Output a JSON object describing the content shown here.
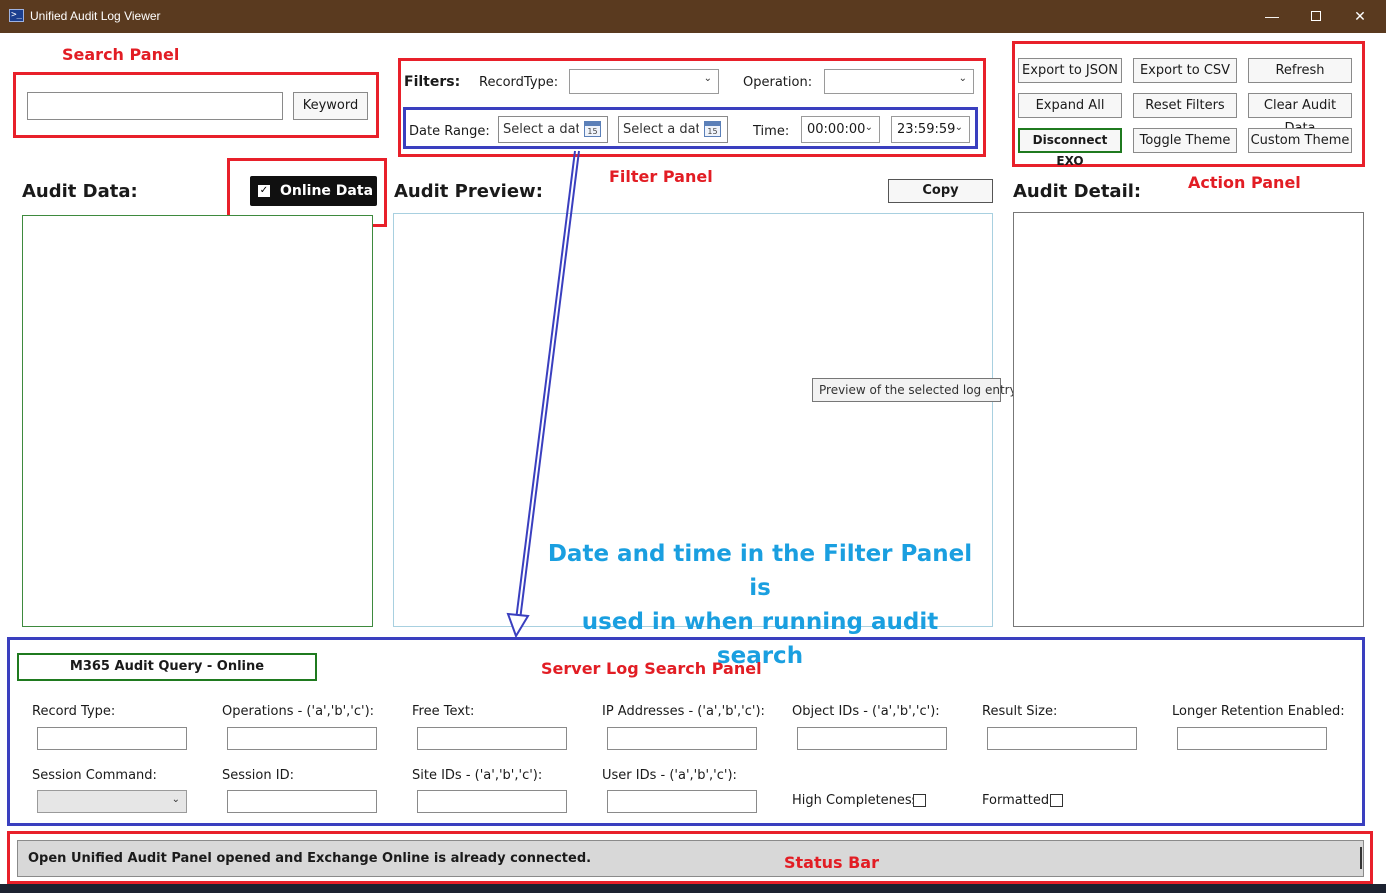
{
  "window": {
    "title": "Unified Audit Log Viewer",
    "min": "—",
    "close": "✕"
  },
  "annotations": {
    "search_panel": "Search Panel",
    "filter_panel": "Filter Panel",
    "action_panel": "Action Panel",
    "server_log_panel": "Server Log Search Panel",
    "status_bar": "Status Bar",
    "note_line1": "Date and time in the Filter Panel is",
    "note_line2": "used in when running audit search"
  },
  "search": {
    "keyword_value": "",
    "keyword_button": "Keyword"
  },
  "filters": {
    "label": "Filters:",
    "record_type_label": "RecordType:",
    "record_type_value": "",
    "operation_label": "Operation:",
    "operation_value": "",
    "date_range_label": "Date Range:",
    "start_date_placeholder": "Select a date",
    "end_date_placeholder": "Select a date",
    "calendar_day": "15",
    "time_label": "Time:",
    "time_start": "00:00:00",
    "time_end": "23:59:59"
  },
  "actions": {
    "export_json": "Export to JSON",
    "export_csv": "Export to CSV",
    "refresh": "Refresh",
    "expand_all": "Expand All",
    "reset_filters": "Reset Filters",
    "clear_audit_data": "Clear Audit Data",
    "disconnect_exo": "Disconnect EXO",
    "toggle_theme": "Toggle Theme",
    "custom_theme": "Custom Theme"
  },
  "audit_data": {
    "heading": "Audit Data:",
    "online_toggle": "Online Data",
    "online_checked": true
  },
  "audit_preview": {
    "heading": "Audit Preview:",
    "copy_button": "Copy",
    "tooltip": "Preview of the selected log entry."
  },
  "audit_detail": {
    "heading": "Audit Detail:"
  },
  "server_search": {
    "query_button": "M365 Audit Query - Online",
    "record_type": "Record Type:",
    "operations": "Operations - ('a','b','c'):",
    "free_text": "Free Text:",
    "ip_addresses": "IP Addresses - ('a','b','c'):",
    "object_ids": "Object IDs - ('a','b','c'):",
    "result_size": "Result Size:",
    "longer_retention": "Longer Retention Enabled:",
    "session_command": "Session Command:",
    "session_id": "Session ID:",
    "site_ids": "Site IDs - ('a','b','c'):",
    "user_ids": "User IDs - ('a','b','c'):",
    "high_completeness": "High Completeness:",
    "formatted": "Formatted:"
  },
  "status": {
    "message": "Open Unified Audit Panel opened and Exchange Online is already connected."
  },
  "colors": {
    "annotation_red": "#e8202a",
    "annotation_blue": "#3a3fbf",
    "note_blue": "#1a9fe0",
    "online_green": "#1f7a1f",
    "titlebar": "#5a3a1f"
  }
}
